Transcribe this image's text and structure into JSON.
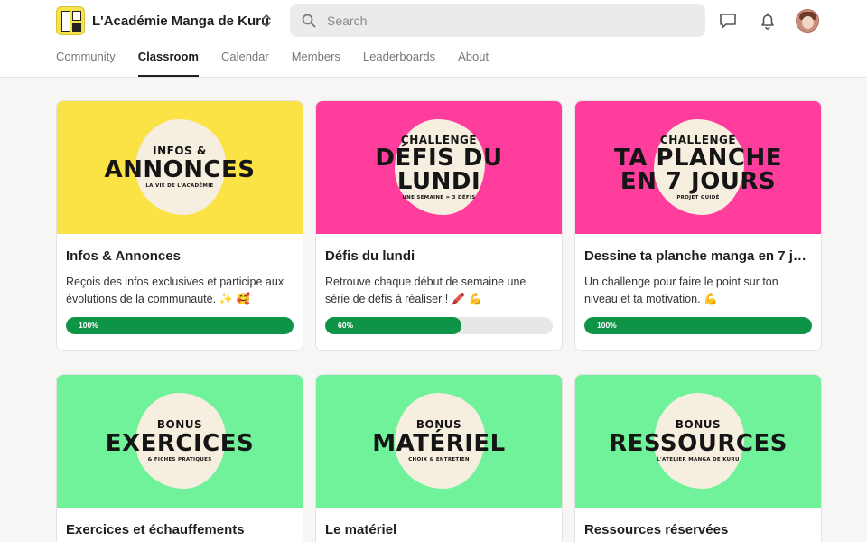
{
  "app": {
    "name": "L'Académie Manga de Kuru"
  },
  "search": {
    "placeholder": "Search"
  },
  "tabs": [
    {
      "label": "Community",
      "active": false
    },
    {
      "label": "Classroom",
      "active": true
    },
    {
      "label": "Calendar",
      "active": false
    },
    {
      "label": "Members",
      "active": false
    },
    {
      "label": "Leaderboards",
      "active": false
    },
    {
      "label": "About",
      "active": false
    }
  ],
  "courses": [
    {
      "banner": {
        "small": "INFOS &",
        "big": "ANNONCES",
        "tiny": "LA VIE DE L'ACADÉMIE",
        "color": "#fbe245"
      },
      "title": "Infos & Annonces",
      "description": "Reçois des infos exclusives et participe aux évolutions de la communauté. ✨ 🥰",
      "progress": 100,
      "progress_label": "100%"
    },
    {
      "banner": {
        "small": "CHALLENGE",
        "big1": "DÉFIS DU",
        "big2": "LUNDI",
        "tiny": "UNE SEMAINE = 3 DÉFIS",
        "color": "#ff3d9c"
      },
      "title": "Défis du lundi",
      "description": "Retrouve chaque début de semaine une série de défis à réaliser ! 🖍️ 💪",
      "progress": 60,
      "progress_label": "60%"
    },
    {
      "banner": {
        "small": "CHALLENGE",
        "big1": "TA PLANCHE",
        "big2": "EN 7 JOURS",
        "tiny": "PROJET GUIDÉ",
        "color": "#ff3d9c"
      },
      "title": "Dessine ta planche manga en 7 jo...",
      "description": "Un challenge pour faire le point sur ton niveau et ta motivation. 💪",
      "progress": 100,
      "progress_label": "100%"
    },
    {
      "banner": {
        "small": "BONUS",
        "big": "EXERCICES",
        "tiny": "& FICHES PRATIQUES",
        "color": "#6ff29a"
      },
      "title": "Exercices et échauffements"
    },
    {
      "banner": {
        "small": "BONUS",
        "big": "MATÉRIEL",
        "tiny": "CHOIX & ENTRETIEN",
        "color": "#6ff29a"
      },
      "title": "Le matériel"
    },
    {
      "banner": {
        "small": "BONUS",
        "big": "RESSOURCES",
        "tiny": "L'ATELIER MANGA DE KURU",
        "color": "#6ff29a"
      },
      "title": "Ressources réservées"
    }
  ]
}
